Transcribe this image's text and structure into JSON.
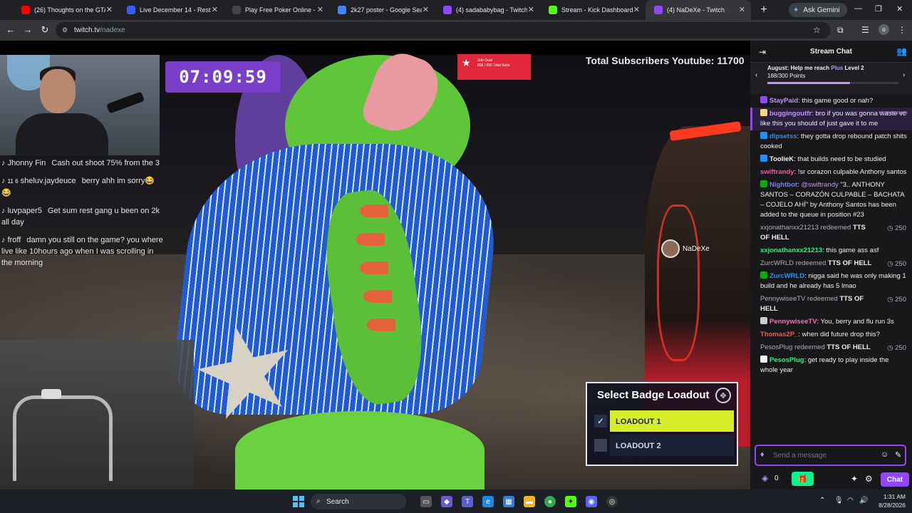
{
  "tabs": [
    {
      "label": "(26) Thoughts on the GTA 6",
      "icon": "youtube-icon",
      "color": "#ff0000"
    },
    {
      "label": "Live December 14 - Restrea",
      "icon": "restream-icon",
      "color": "#3a5bf5"
    },
    {
      "label": "Play Free Poker Online - Fre",
      "icon": "poker-icon",
      "color": "#444444"
    },
    {
      "label": "2k27 poster - Google Searc",
      "icon": "google-icon",
      "color": "#4285f4"
    },
    {
      "label": "(4) sadababybag - Twitch",
      "icon": "twitch-icon",
      "color": "#9147ff"
    },
    {
      "label": "Stream - Kick Dashboard",
      "icon": "kick-icon",
      "color": "#53fc18"
    },
    {
      "label": "(4) NaDeXe - Twitch",
      "icon": "twitch-icon",
      "color": "#9147ff",
      "active": true
    }
  ],
  "gemini_label": "Ask Gemini",
  "address": {
    "host": "twitch.tv",
    "path": "/nadexe"
  },
  "profile_initial": "o",
  "video": {
    "timer": "07:09:59",
    "sub_goal_title": "Sub Goal",
    "sub_goal_text": "658 / 650 Total Subs",
    "youtube_subs": "Total Subscribers Youtube: 11700",
    "player_tag": "NaDeXe",
    "overlay_chat": [
      {
        "name": "Jhonny Fin",
        "text": "Cash out shoot 75% from the 3"
      },
      {
        "name": "sheluv.jaydeuce",
        "badges": "11  6",
        "text": "berry ahh im sorry😂😂"
      },
      {
        "name": "luvpaper5",
        "text": "Get sum rest gang u been on 2k all day"
      },
      {
        "name": "froff",
        "text": "damn you still on the game? you where live like 10hours ago when I was scrolling in the morning"
      }
    ],
    "badge_loadout": {
      "title": "Select Badge Loadout",
      "options": [
        "LOADOUT 1",
        "LOADOUT 2"
      ],
      "selected": 0
    }
  },
  "chat": {
    "title": "Stream Chat",
    "goal": {
      "line1_prefix": "August: Help me reach ",
      "line1_plus": "Plus",
      "line1_suffix": " Level 2",
      "points": "188/300 Points",
      "progress": 0.63
    },
    "messages": [
      {
        "type": "msg",
        "user": "StayPaid",
        "color": "#bf94ff",
        "badge": "#9147ff",
        "text": "this game good or nah?"
      },
      {
        "type": "msg",
        "user": "buggingoutfr",
        "color": "#bf94ff",
        "badge": "#ffd37a",
        "text": "bro if you was gonna waste vc like this you should of just gave it to me",
        "highlight": true,
        "flag": "FIRST MESSAGE"
      },
      {
        "type": "msg",
        "user": "dipsetss",
        "color": "#1e90ff",
        "badge": "#1e90ff",
        "text": "they gotta drop rebound patch shits cooked"
      },
      {
        "type": "msg",
        "user": "TooIieK",
        "color": "#efeff1",
        "badge": "#1e90ff",
        "text": "that builds need to be studied"
      },
      {
        "type": "msg",
        "user": "swiftrandy",
        "color": "#ff4f9a",
        "text": "!sr corazon culpable Anthony santos"
      },
      {
        "type": "msg",
        "user": "Nightbot",
        "color": "#7b7bff",
        "badge": "#00ad03",
        "mention": "@swiftrandy",
        "text": "\"3.. ANTHONY SANTOS – CORAZÓN CULPABLE – BACHATA – COJELO AHÍ\" by Anthony Santos has been added to the queue in position #23"
      },
      {
        "type": "redeem",
        "user": "xxjonathanxx21213",
        "action": "redeemed",
        "reward": "TTS OF HELL",
        "points": "250"
      },
      {
        "type": "msg",
        "user": "xxjonathanxx21213",
        "color": "#00ff7f",
        "text": "this game ass asf"
      },
      {
        "type": "redeem",
        "user": "ZurcWRLD",
        "action": "redeemed",
        "reward": "TTS OF HELL",
        "points": "250"
      },
      {
        "type": "msg",
        "user": "ZurcWRLD",
        "color": "#1e90ff",
        "badge": "#00ad03",
        "text": "nigga said he was only making 1 build and he already has 5 lmao"
      },
      {
        "type": "redeem",
        "user": "PennywiseeTV",
        "action": "redeemed",
        "reward": "TTS OF HELL",
        "points": "250"
      },
      {
        "type": "msg",
        "user": "PennywiseeTV",
        "color": "#ff69b4",
        "badge": "#cccccc",
        "text": "You, berry and flu run 3s"
      },
      {
        "type": "msg",
        "user": "Thomas2P_",
        "color": "#ff4f4f",
        "text": "when did future drop this?"
      },
      {
        "type": "redeem",
        "user": "PesosPlug",
        "action": "redeemed",
        "reward": "TTS OF HELL",
        "points": "250"
      },
      {
        "type": "msg",
        "user": "PesosPlug",
        "color": "#00ff7f",
        "badge": "#efeff1",
        "text": "get ready to play inside the whole year"
      }
    ],
    "composer_placeholder": "Send a message",
    "points_value": "0",
    "send_label": "Chat"
  },
  "taskbar": {
    "search_label": "Search",
    "time": "1:31 AM",
    "date": "8/28/2026"
  }
}
